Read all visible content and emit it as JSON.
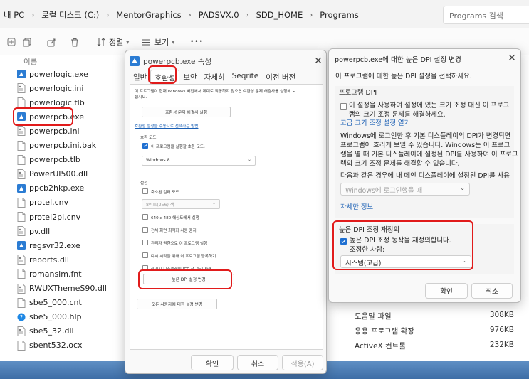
{
  "explorer": {
    "breadcrumb": [
      {
        "label": "내 PC"
      },
      {
        "label": "로컬 디스크 (C:)"
      },
      {
        "label": "MentorGraphics"
      },
      {
        "label": "PADSVX.0"
      },
      {
        "label": "SDD_HOME"
      },
      {
        "label": "Programs"
      }
    ],
    "search_placeholder": "Programs 검색",
    "toolbar": {
      "sort_label": "정렬",
      "view_label": "보기",
      "more_label": "•••"
    },
    "column_name": "이름",
    "files": [
      {
        "name": "powerlogic.exe",
        "icon": "exe-icon"
      },
      {
        "name": "powerlogic.ini",
        "icon": "config-file-icon"
      },
      {
        "name": "powerlogic.tlb",
        "icon": "file-icon"
      },
      {
        "name": "powerpcb.exe",
        "icon": "exe-icon"
      },
      {
        "name": "powerpcb.ini",
        "icon": "config-file-icon"
      },
      {
        "name": "powerpcb.ini.bak",
        "icon": "file-icon"
      },
      {
        "name": "powerpcb.tlb",
        "icon": "file-icon"
      },
      {
        "name": "PowerUI500.dll",
        "icon": "dll-icon"
      },
      {
        "name": "ppcb2hkp.exe",
        "icon": "exe-icon"
      },
      {
        "name": "protel.cnv",
        "icon": "file-icon"
      },
      {
        "name": "protel2pl.cnv",
        "icon": "file-icon"
      },
      {
        "name": "pv.dll",
        "icon": "dll-icon"
      },
      {
        "name": "regsvr32.exe",
        "icon": "exe-icon"
      },
      {
        "name": "reports.dll",
        "icon": "dll-icon"
      },
      {
        "name": "romansim.fnt",
        "icon": "file-icon"
      },
      {
        "name": "RWUXThemeS90.dll",
        "icon": "dll-icon"
      },
      {
        "name": "sbe5_000.cnt",
        "icon": "file-icon"
      },
      {
        "name": "sbe5_000.hlp",
        "icon": "help-file-icon"
      },
      {
        "name": "sbe5_32.dll",
        "icon": "dll-icon"
      },
      {
        "name": "sbent532.ocx",
        "icon": "file-icon"
      }
    ],
    "details": [
      {
        "type": "도움말 파일",
        "size": "308KB"
      },
      {
        "type": "응용 프로그램 확장",
        "size": "976KB"
      },
      {
        "type": "ActiveX 컨트롤",
        "size": "232KB"
      }
    ]
  },
  "props_dialog": {
    "title": "powerpcb.exe 속성",
    "tabs": [
      "일반",
      "호환성",
      "보안",
      "자세히",
      "Seqrite",
      "이전 버전"
    ],
    "intro": "이 프로그램이 현재 Windows 버전에서 제대로 작동하지 않으면 호환성 문제 해결사를 실행해 보십시오.",
    "troubleshooter_button": "호환성 문제 해결사 실행",
    "manual_link": "호환성 설정을 수동으로 선택하는 방법",
    "compat_mode_heading": "호환 모드",
    "compat_mode_checkbox": "이 프로그램을 실행할 호환 모드:",
    "compat_mode_value": "Windows 8",
    "settings_heading": "설정",
    "options": [
      {
        "label": "축소된 컬러 모드",
        "checked": false
      },
      {
        "label": "640 x 480 해상도에서 실행",
        "checked": false
      },
      {
        "label": "전체 화면 최적화 사용 중지",
        "checked": false
      },
      {
        "label": "관리자 권한으로 이 프로그램 실행",
        "checked": false
      },
      {
        "label": "다시 시작을 위해 이 프로그램 등록하기",
        "checked": false
      },
      {
        "label": "레거시 디스플레이 ICC 색 관리 사용",
        "checked": false
      }
    ],
    "color_mode_value": "8비트(256) 색",
    "dpi_button": "높은 DPI 설정 변경",
    "all_users_button": "모든 사용자에 대한 설정 변경",
    "ok_button": "확인",
    "cancel_button": "취소",
    "apply_button": "적용(A)"
  },
  "dpi_dialog": {
    "title": "powerpcb.exe에 대한 높은 DPI 설정 변경",
    "prompt": "이 프로그램에 대한 높은 DPI 설정을 선택하세요.",
    "program_dpi_heading": "프로그램 DPI",
    "program_dpi_checkbox_line1": "이 설정을 사용하여 설정에 있는 크기 조정 대신 이 프로그",
    "program_dpi_checkbox_line2": "램의 크기 조정 문제를 해결하세요.",
    "advanced_link": "고급 크기 조정 설정 열기",
    "explain_line1": "Windows에 로그인한 후 기본 디스플레이의 DPI가 변경되면",
    "explain_line2": "프로그램이 흐리게 보일 수 있습니다. Windows는 이 프로그",
    "explain_line3": "램을 열 때 기본 디스플레이에 설정된 DPI를 사용하여 이 프로그",
    "explain_line4": "램의 크기 조정 문제를 해결할 수 있습니다.",
    "use_dpi_label": "다음과 같은 경우에 내 메인 디스플레이에 설정된 DPI를 사용",
    "use_dpi_value": "Windows에 로그인했을 때",
    "more_info_link": "자세한 정보",
    "override_heading": "높은 DPI 조정 재정의",
    "override_checkbox_line1": "높은 DPI 조정 동작을 재정의합니다.",
    "override_checkbox_line2": "조정한 사람:",
    "override_value": "시스템(고급)",
    "ok_button": "확인",
    "cancel_button": "취소"
  },
  "colors": {
    "accent": "#1e6fd1",
    "highlight": "#e11b1b",
    "link": "#1a5fb4"
  }
}
